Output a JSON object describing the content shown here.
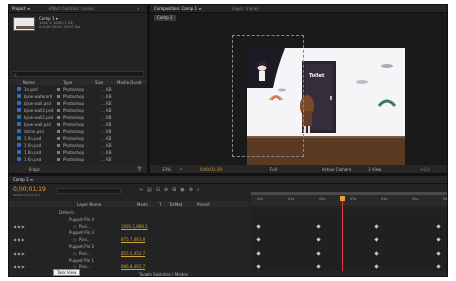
{
  "project_panel": {
    "tabs": [
      "Project ≡",
      "Effect Controls: (none)"
    ],
    "comp_name": "Comp 1 ▾",
    "comp_info": [
      "1440 × 1080 (1.33)",
      "Δ 0;00;30;00, 29.97 fps"
    ],
    "search_placeholder": "ρ",
    "headers": [
      "Name",
      "Type",
      "Size",
      "Media Durat"
    ],
    "files": [
      {
        "name": "1n.psd",
        "type": "Photoshop",
        "size": "... KB"
      },
      {
        "name": "bjsw-waterord",
        "type": "Photoshop",
        "size": "... KB"
      },
      {
        "name": "bjsw-wall.psd",
        "type": "Photoshop",
        "size": "... KB"
      },
      {
        "name": "bjsw-wall2.psd",
        "type": "Photoshop",
        "size": "... KB"
      },
      {
        "name": "bjsw-wall2.psd",
        "type": "Photoshop",
        "size": "... KB"
      },
      {
        "name": "bjsw-wall.psd",
        "type": "Photoshop",
        "size": "... KB"
      },
      {
        "name": "dome.psd",
        "type": "Photoshop",
        "size": "... KB"
      },
      {
        "name": "1 6n.psd",
        "type": "Photoshop",
        "size": "... KB"
      },
      {
        "name": "1 6n.psd",
        "type": "Photoshop",
        "size": "... KB"
      },
      {
        "name": "1 6n.psd",
        "type": "Photoshop",
        "size": "... KB"
      },
      {
        "name": "1 6n.psd",
        "type": "Photoshop",
        "size": "... KB"
      }
    ],
    "footer": "8 bpc"
  },
  "viewer": {
    "tabs": [
      "Composition: Comp 1 ≡",
      "Layer: (none)"
    ],
    "breadcrumb": "Comp 1",
    "door_sign": "Toilet",
    "footer": [
      "33%",
      "0;00;01;19",
      "Full",
      "Active Camera",
      "1 View",
      "+0.0"
    ]
  },
  "timeline": {
    "tab": "Comp 1 ≡",
    "timecode": "0;00;01;19",
    "timecode_sub": "00049 (29.97 fps)",
    "headers": [
      "Layer Name",
      "Mode",
      "T",
      "TrkMat",
      "Parent"
    ],
    "ruler": [
      "00s",
      "01s",
      "02s",
      "03s",
      "04s",
      "05s",
      "06s"
    ],
    "layers": [
      {
        "indent": 2,
        "label": "Deform"
      },
      {
        "indent": 3,
        "label": "Puppet Pin 4"
      },
      {
        "indent": 4,
        "label": "Posi...",
        "value": "1091.1,889.2"
      },
      {
        "indent": 3,
        "label": "Puppet Pin 3"
      },
      {
        "indent": 4,
        "label": "Posi...",
        "value": "875.7,463.9"
      },
      {
        "indent": 3,
        "label": "Puppet Pin 2"
      },
      {
        "indent": 4,
        "label": "Posi...",
        "value": "855.5,452.7"
      },
      {
        "indent": 3,
        "label": "Puppet Pin 1"
      },
      {
        "indent": 4,
        "label": "Posi...",
        "value": "886.8,462.7"
      }
    ],
    "footer_label": "Toggle Switches / Modes",
    "tooltip": "Task View"
  },
  "colors": {
    "accent": "#e8a23a",
    "playhead": "#e03a3a",
    "timecode": "#e8a23a",
    "value": "#d4a23c"
  }
}
